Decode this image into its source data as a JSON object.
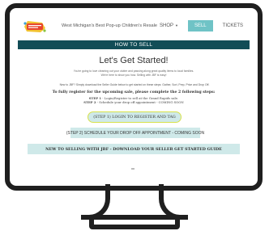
{
  "site": {
    "title": "West Michigan's Best Pop-up Children's Resale",
    "logo_text": "Kids Closet Connection"
  },
  "nav": {
    "items": [
      {
        "label": "SHOP",
        "has_caret": true
      },
      {
        "label": "SELL",
        "active": true
      },
      {
        "label": "TICKETS"
      }
    ]
  },
  "section": {
    "title": "HOW TO SELL"
  },
  "content": {
    "heading": "Let's Get Started!",
    "intro_line1": "You're going to love cleaning out your clutter and passing along great quality items to local families.",
    "intro_line2": "We're here to show you how.  Selling with JBF is easy!",
    "new_line": "New to JBF?  Simply download the Seller Guide below to get started on these steps: Gather, Sort, Prep, Price and Drop Off.",
    "register_title": "To fully register for the upcoming sale, please complete the 2 following steps:",
    "step1_label": "STEP 1",
    "step1_text": " - Login/Register to sell at the Grand Rapids sale.",
    "step2_label": "STEP 2",
    "step2_text": " - Schedule your drop off appointment - COMING SOON"
  },
  "buttons": {
    "login": "(STEP 1) LOGIN TO REGISTER AND TAG",
    "schedule": "(STEP 2) SCHEDULE YOUR DROP OFF APPOINTMENT - COMING SOON",
    "guide": "NEW TO SELLING WITH JBF - DOWNLOAD YOUR SELLER GET STARTED GUIDE"
  },
  "colors": {
    "section_bar": "#124d57",
    "accent": "#6fc3c6",
    "button_bg": "#cfe9e9",
    "login_border": "#d8e24a",
    "monitor": "#1f1f1f"
  },
  "icons": {
    "logo": "kids-closet-logo",
    "monitor": "monitor-frame"
  }
}
